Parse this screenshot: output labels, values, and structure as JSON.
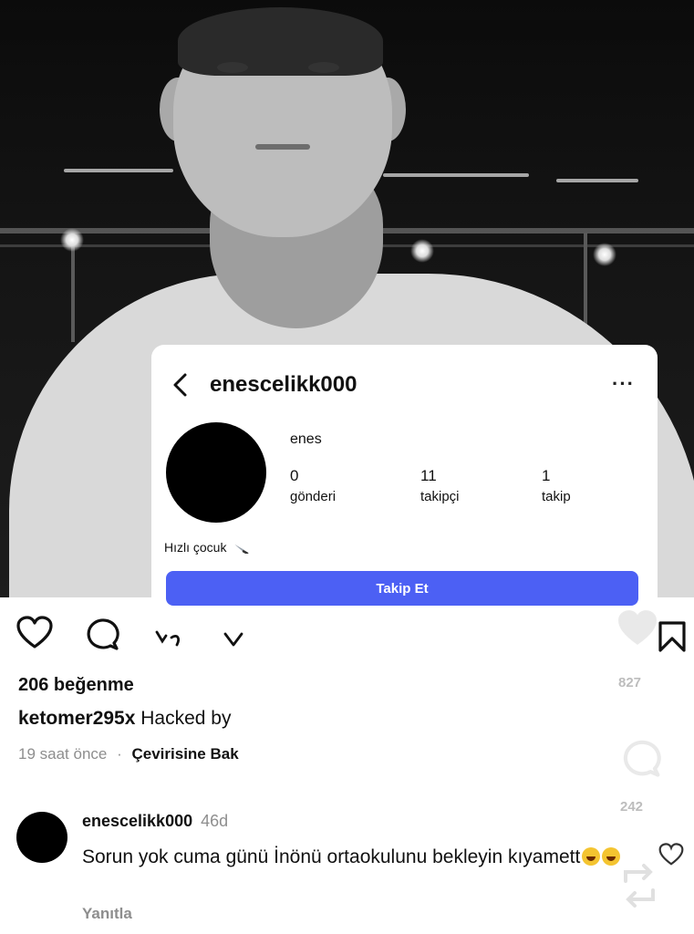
{
  "profile": {
    "username": "enescelikk000",
    "display_name": "enes",
    "stats": [
      {
        "value": "0",
        "label": "gönderi"
      },
      {
        "value": "11",
        "label": "takipçi"
      },
      {
        "value": "1",
        "label": "takip"
      }
    ],
    "bio": "Hızlı çocuk",
    "follow_label": "Takip Et",
    "colors": {
      "follow_button": "#4c60f4"
    }
  },
  "post": {
    "likes": "206 beğenme",
    "caption_user": "ketomer295x",
    "caption_text": "Hacked by",
    "time": "19 saat önce",
    "separator": "·",
    "translate": "Çevirisine Bak"
  },
  "overlay": {
    "like_count": "827",
    "comment_count": "242"
  },
  "comment": {
    "user": "enescelikk000",
    "age": "46d",
    "text": "Sorun yok cuma günü İnönü ortaokulunu bekleyin kıyamett",
    "reply": "Yanıtla"
  },
  "icons": [
    "chevron-left-icon",
    "more-icon",
    "knife-icon",
    "heart-icon",
    "comment-icon",
    "share-icon",
    "chevron-down-icon",
    "bookmark-icon",
    "repost-icon",
    "laughing-emoji"
  ]
}
